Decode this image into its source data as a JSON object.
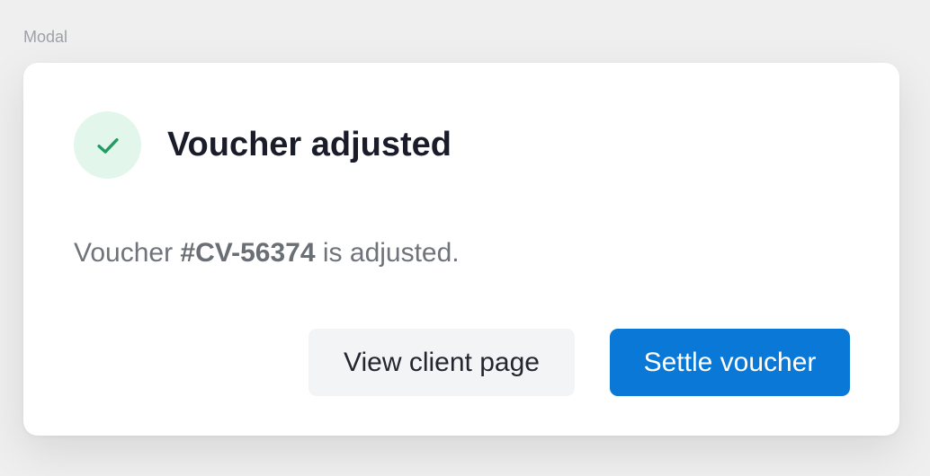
{
  "frame_label": "Modal",
  "modal": {
    "title": "Voucher adjusted",
    "icon": "check-icon",
    "message_prefix": "Voucher ",
    "voucher_id": "#CV-56374",
    "message_suffix": " is adjusted.",
    "buttons": {
      "secondary_label": "View client page",
      "primary_label": "Settle voucher"
    }
  },
  "colors": {
    "success": "#1f9d63",
    "success_bg": "#e3f6ec",
    "primary": "#0a78d6",
    "secondary_bg": "#f3f4f6"
  }
}
